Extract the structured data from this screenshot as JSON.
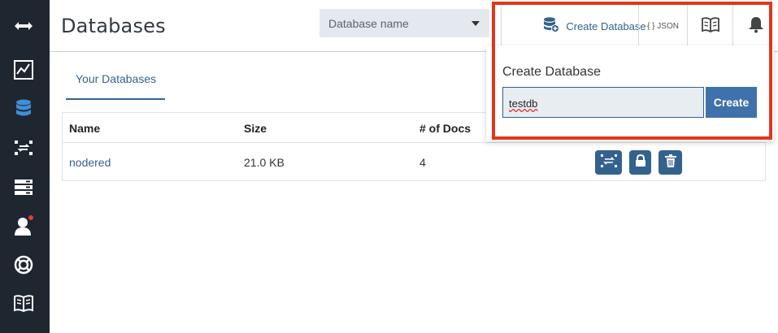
{
  "header": {
    "title": "Databases",
    "db_select_placeholder": "Database name",
    "create_db_label": "Create Database",
    "json_label": "{ } JSON"
  },
  "sidebar": {
    "items": [
      {
        "icon": "expand-arrows-icon"
      },
      {
        "icon": "activity-chart-icon"
      },
      {
        "icon": "databases-icon",
        "active": true
      },
      {
        "icon": "replication-icon"
      },
      {
        "icon": "server-config-icon"
      },
      {
        "icon": "user-notification-icon"
      },
      {
        "icon": "support-lifebuoy-icon"
      },
      {
        "icon": "documentation-book-icon"
      }
    ]
  },
  "tabs": [
    {
      "label": "Your Databases",
      "active": true
    }
  ],
  "table": {
    "columns": [
      "Name",
      "Size",
      "# of Docs"
    ],
    "rows": [
      {
        "name": "nodered",
        "size": "21.0 KB",
        "docs": "4"
      }
    ]
  },
  "popup": {
    "title": "Create Database",
    "input_value": "testdb",
    "create_label": "Create"
  },
  "colors": {
    "sidebar_bg": "#1e2630",
    "accent": "#34628f",
    "highlight_border": "#e2361a"
  }
}
